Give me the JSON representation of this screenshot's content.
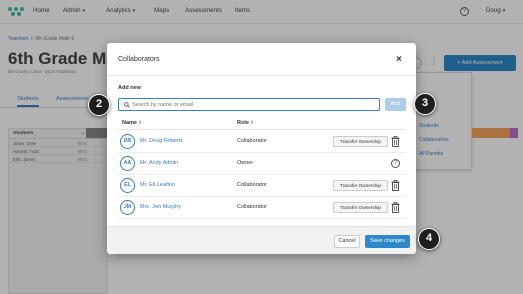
{
  "nav": {
    "items": [
      "Home",
      "Admin",
      "Analytics",
      "Maps",
      "Assessments",
      "Items"
    ],
    "user": "Doug"
  },
  "breadcrumb": {
    "parent": "Teachers",
    "separator": ">",
    "current": "6th Grade Math 6"
  },
  "page": {
    "title": "6th Grade Math 6",
    "subtitle": "6th Grade | Class - 2018 Traditional"
  },
  "tabs": [
    "Students",
    "Assessments"
  ],
  "roster": {
    "header": "Students",
    "rows": [
      {
        "name": "Jones, Dave",
        "code": "8001"
      },
      {
        "name": "Howard, Todd",
        "code": "8002"
      },
      {
        "name": "Ellis, James",
        "code": "8003"
      }
    ]
  },
  "background": {
    "add_assessment_label": "+ Add Assessment",
    "dropdown_items": [
      "Students",
      "Collaborators",
      "All Parents"
    ]
  },
  "modal": {
    "title": "Collaborators",
    "close_symbol": "×",
    "add_new_label": "Add new",
    "search_placeholder": "Search by name or email",
    "add_button": "Add",
    "columns": {
      "name": "Name",
      "role": "Role",
      "sort_symbol": "⇕"
    },
    "collaborators": [
      {
        "initials": "DR",
        "name": "Mr. Doug Roberts",
        "role": "Collaborator",
        "action": "Transfer Ownership"
      },
      {
        "initials": "AA",
        "name": "Mr. Andy Admin",
        "role": "Owner",
        "action": ""
      },
      {
        "initials": "EL",
        "name": "Mr. Eli Leafton",
        "role": "Collaborator",
        "action": "Transfer Ownership"
      },
      {
        "initials": "JM",
        "name": "Mrs. Jen Murphy",
        "role": "Collaborator",
        "action": "Transfer Ownership"
      }
    ],
    "cancel_button": "Cancel",
    "save_button": "Save changes"
  },
  "steps": [
    "2",
    "3",
    "4"
  ],
  "colors": {
    "accent": "#2d88c9",
    "link": "#3b7bd0",
    "add_disabled": "#aecde8"
  }
}
